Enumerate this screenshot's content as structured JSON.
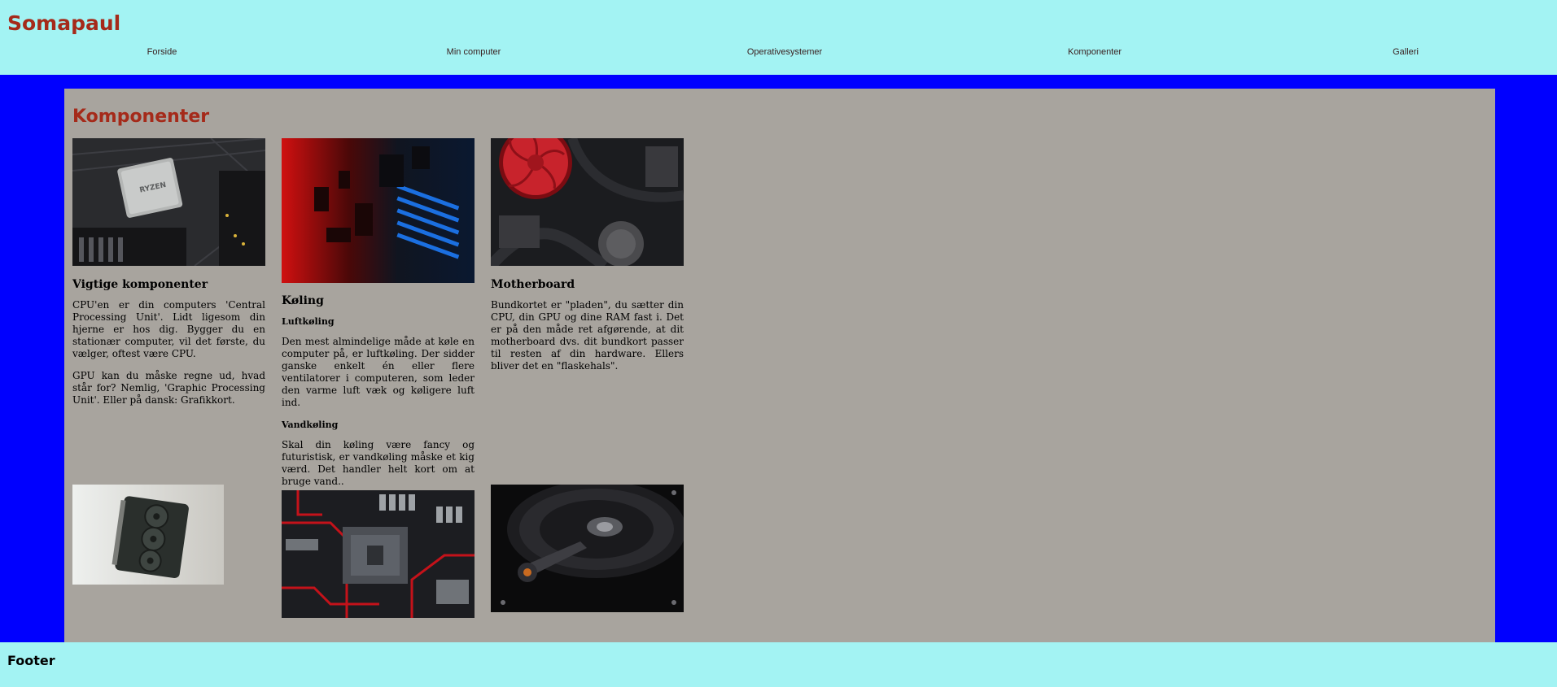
{
  "site": {
    "logo": "Somapaul"
  },
  "nav": {
    "items": [
      {
        "label": "Forside"
      },
      {
        "label": "Min computer"
      },
      {
        "label": "Operativesystemer"
      },
      {
        "label": "Komponenter"
      },
      {
        "label": "Galleri"
      }
    ]
  },
  "main": {
    "title": "Komponenter",
    "sections": [
      {
        "heading": "Vigtige komponenter",
        "paragraphs": [
          "CPU'en er din computers 'Central Processing Unit'. Lidt ligesom din hjerne er hos dig. Bygger du en stationær computer, vil det første, du vælger, oftest være CPU.",
          "GPU kan du måske regne ud, hvad står for? Nemlig, 'Graphic Processing Unit'. Eller på dansk: Grafikkort."
        ]
      },
      {
        "heading": "Køling",
        "subsections": [
          {
            "heading": "Luftkøling",
            "text": "Den mest almindelige måde at køle en computer på, er luftkøling. Der sidder ganske enkelt én eller flere ventilatorer i computeren, som leder den varme luft væk og køligere luft ind."
          },
          {
            "heading": "Vandkøling",
            "text": "Skal din køling være fancy og futuristisk, er vandkøling måske et kig værd. Det handler helt kort om at bruge vand.."
          }
        ]
      },
      {
        "heading": "Motherboard",
        "paragraphs": [
          "Bundkortet er \"pladen\", du sætter din CPU, din GPU og dine RAM fast i. Det er på den måde ret afgørende, at dit motherboard dvs. dit bundkort passer til resten af din hardware. Ellers bliver det en \"flaskehals\"."
        ]
      }
    ],
    "images": [
      {
        "icon": "cpu-ryzen-photo",
        "chip_text": "RYZEN"
      },
      {
        "icon": "red-blue-circuit-photo"
      },
      {
        "icon": "red-fan-cooler-photo"
      },
      {
        "icon": "graphics-card-photo"
      },
      {
        "icon": "motherboard-socket-photo"
      },
      {
        "icon": "hard-drive-photo"
      }
    ]
  },
  "footer": {
    "text": "Footer"
  },
  "colors": {
    "header_bg": "#a3f3f3",
    "page_bg": "#0000ff",
    "content_bg": "#a8a49e",
    "accent": "#a52a1a"
  }
}
